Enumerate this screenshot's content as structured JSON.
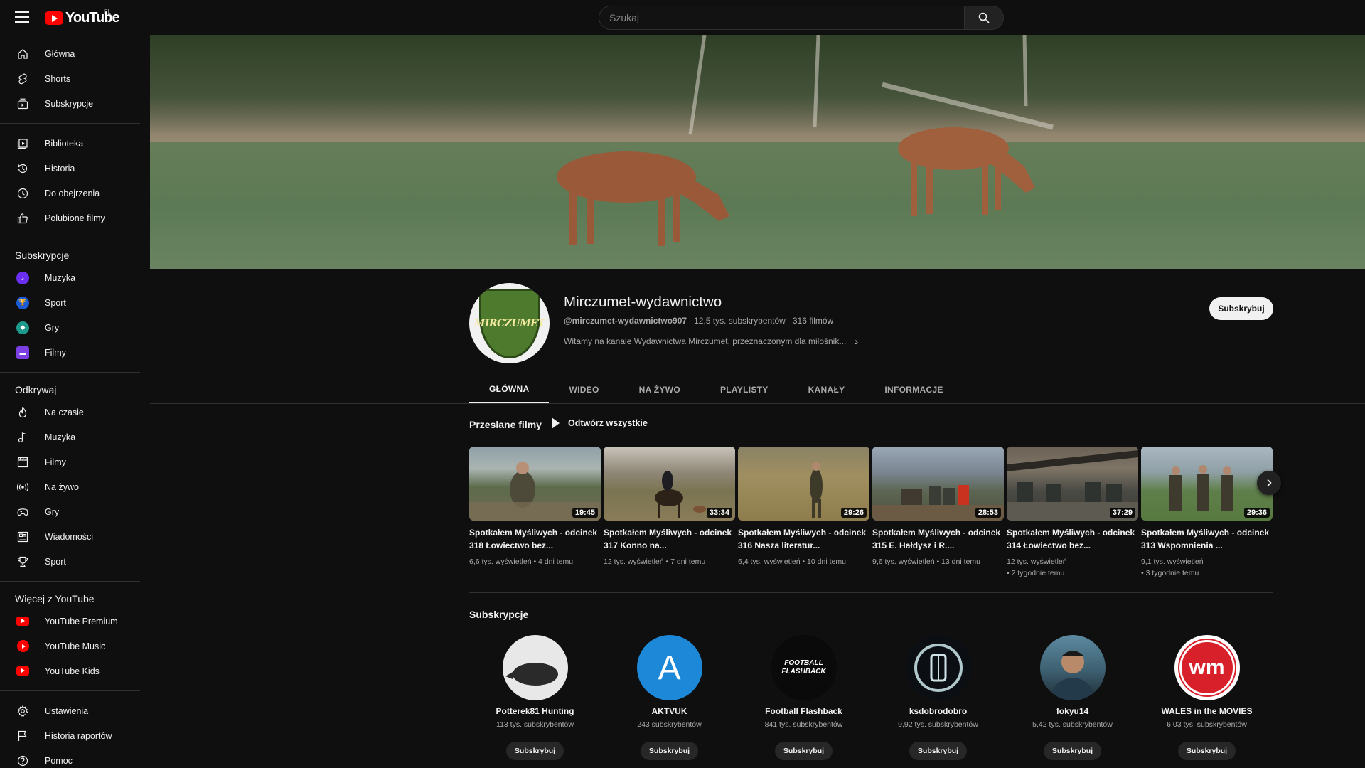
{
  "topbar": {
    "logo_text": "YouTube",
    "country": "PL",
    "search_placeholder": "Szukaj"
  },
  "sidebar": {
    "main": [
      {
        "label": "Główna",
        "icon": "home-icon"
      },
      {
        "label": "Shorts",
        "icon": "shorts-icon"
      },
      {
        "label": "Subskrypcje",
        "icon": "subscriptions-icon"
      }
    ],
    "library": [
      {
        "label": "Biblioteka",
        "icon": "library-icon"
      },
      {
        "label": "Historia",
        "icon": "history-icon"
      },
      {
        "label": "Do obejrzenia",
        "icon": "watch-later-icon"
      },
      {
        "label": "Polubione filmy",
        "icon": "thumbs-up-icon"
      }
    ],
    "subscriptions_heading": "Subskrypcje",
    "subscriptions": [
      {
        "label": "Muzyka",
        "color": "#6a2ff2"
      },
      {
        "label": "Sport",
        "color": "#1a5cd6"
      },
      {
        "label": "Gry",
        "color": "#1e9a8c"
      },
      {
        "label": "Filmy",
        "color": "#7b3fe4"
      }
    ],
    "explore_heading": "Odkrywaj",
    "explore": [
      {
        "label": "Na czasie",
        "icon": "trending-icon"
      },
      {
        "label": "Muzyka",
        "icon": "music-note-icon"
      },
      {
        "label": "Filmy",
        "icon": "clapperboard-icon"
      },
      {
        "label": "Na żywo",
        "icon": "live-icon"
      },
      {
        "label": "Gry",
        "icon": "gamepad-icon"
      },
      {
        "label": "Wiadomości",
        "icon": "news-icon"
      },
      {
        "label": "Sport",
        "icon": "trophy-icon"
      }
    ],
    "more_heading": "Więcej z YouTube",
    "more": [
      {
        "label": "YouTube Premium"
      },
      {
        "label": "YouTube Music"
      },
      {
        "label": "YouTube Kids"
      }
    ],
    "settings": [
      {
        "label": "Ustawienia",
        "icon": "gear-icon"
      },
      {
        "label": "Historia raportów",
        "icon": "flag-icon"
      },
      {
        "label": "Pomoc",
        "icon": "help-icon"
      }
    ]
  },
  "channel": {
    "avatar_text": "MIRCZUMET",
    "title": "Mirczumet-wydawnictwo",
    "handle": "@mirczumet-wydawnictwo907",
    "subscribers": "12,5 tys. subskrybentów",
    "videos_count": "316 filmów",
    "description": "Witamy na kanale Wydawnictwa Mirczumet, przeznaczonym dla miłośnik...",
    "subscribe_label": "Subskrybuj"
  },
  "tabs": [
    {
      "label": "GŁÓWNA",
      "active": true
    },
    {
      "label": "WIDEO",
      "active": false
    },
    {
      "label": "NA ŻYWO",
      "active": false
    },
    {
      "label": "PLAYLISTY",
      "active": false
    },
    {
      "label": "KANAŁY",
      "active": false
    },
    {
      "label": "INFORMACJE",
      "active": false
    }
  ],
  "uploads": {
    "title": "Przesłane filmy",
    "play_all": "Odtwórz wszystkie",
    "videos": [
      {
        "title": "Spotkałem Myśliwych - odcinek 318 Łowiectwo bez...",
        "duration": "19:45",
        "meta1": "6,6 tys. wyświetleń • 4 dni temu",
        "meta2": ""
      },
      {
        "title": "Spotkałem Myśliwych - odcinek 317 Konno na...",
        "duration": "33:34",
        "meta1": "12 tys. wyświetleń • 7 dni temu",
        "meta2": ""
      },
      {
        "title": "Spotkałem Myśliwych - odcinek 316 Nasza literatur...",
        "duration": "29:26",
        "meta1": "6,4 tys. wyświetleń • 10 dni temu",
        "meta2": ""
      },
      {
        "title": "Spotkałem Myśliwych - odcinek 315 E. Hałdysz i R....",
        "duration": "28:53",
        "meta1": "9,6 tys. wyświetleń • 13 dni temu",
        "meta2": ""
      },
      {
        "title": "Spotkałem Myśliwych - odcinek 314 Łowiectwo bez...",
        "duration": "37:29",
        "meta1": "12 tys. wyświetleń",
        "meta2": "• 2 tygodnie temu"
      },
      {
        "title": "Spotkałem Myśliwych - odcinek 313 Wspomnienia ...",
        "duration": "29:36",
        "meta1": "9,1 tys. wyświetleń",
        "meta2": "• 3 tygodnie temu"
      }
    ]
  },
  "subscriptions_section": {
    "title": "Subskrypcje",
    "channels": [
      {
        "name": "Potterek81 Hunting",
        "subs": "113 tys. subskrybentów",
        "button": "Subskrybuj",
        "avatar_text": ""
      },
      {
        "name": "AKTVUK",
        "subs": "243 subskrybentów",
        "button": "Subskrybuj",
        "avatar_text": "A"
      },
      {
        "name": "Football Flashback",
        "subs": "841 tys. subskrybentów",
        "button": "Subskrybuj",
        "avatar_text": "FOOTBALL FLASHBACK"
      },
      {
        "name": "ksdobrodobro",
        "subs": "9,92 tys. subskrybentów",
        "button": "Subskrybuj",
        "avatar_text": ""
      },
      {
        "name": "fokyu14",
        "subs": "5,42 tys. subskrybentów",
        "button": "Subskrybuj",
        "avatar_text": ""
      },
      {
        "name": "WALES in the MOVIES",
        "subs": "6,03 tys. subskrybentów",
        "button": "Subskrybuj",
        "avatar_text": "wm"
      }
    ]
  }
}
